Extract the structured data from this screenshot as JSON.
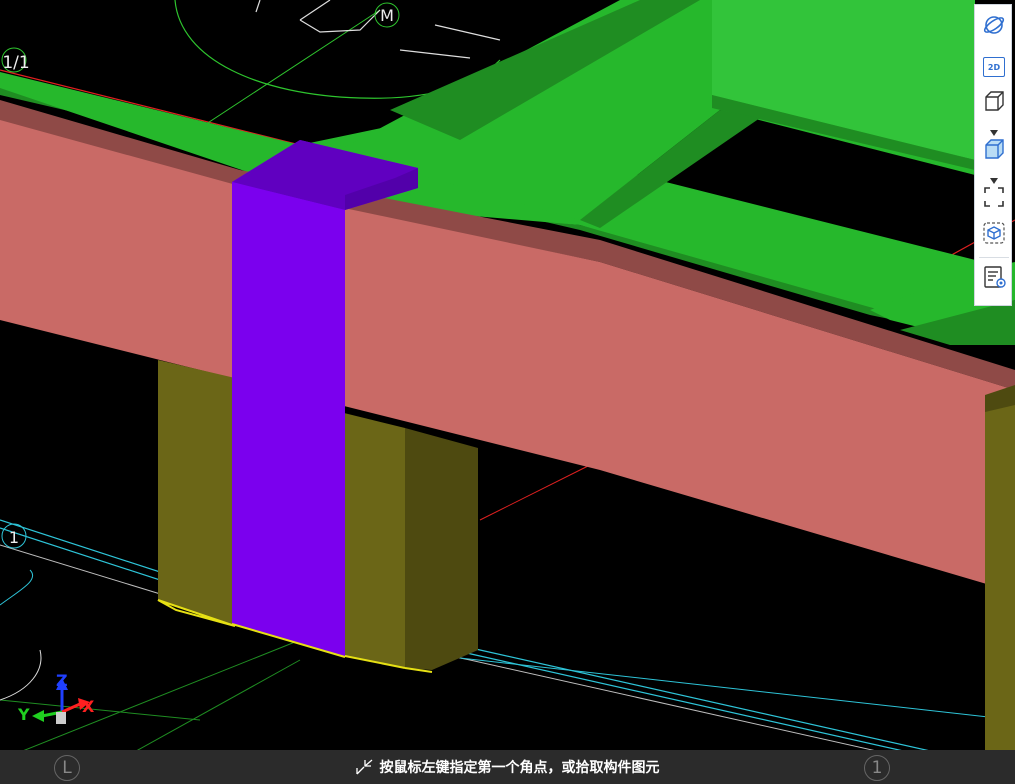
{
  "viewport": {
    "grid_labels": {
      "top_left": "1/1",
      "top_mid": "M",
      "mid_left": "1",
      "bottom_left": "L",
      "bottom_right": "1"
    },
    "axis_gizmo": {
      "x": "X",
      "y": "Y",
      "z": "Z"
    }
  },
  "toolbar": {
    "items": [
      {
        "icon": "orbit-icon"
      },
      {
        "icon": "view-2d-icon",
        "label": "2D"
      },
      {
        "icon": "view-3d-box-icon"
      },
      {
        "icon": "display-mode-icon"
      },
      {
        "icon": "zoom-extent-icon"
      },
      {
        "icon": "select-cube-icon"
      },
      {
        "icon": "property-view-icon"
      }
    ]
  },
  "statusbar": {
    "message": "按鼠标左键指定第一个角点，或拾取构件图元"
  },
  "colors": {
    "slab": "#26b82c",
    "beam": "#c96a66",
    "column_highlight": "#7b00ee",
    "column": "#6b6617"
  }
}
